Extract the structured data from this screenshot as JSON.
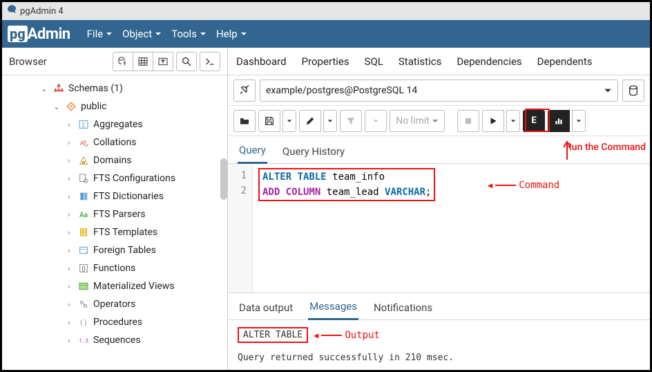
{
  "window": {
    "title": "pgAdmin 4"
  },
  "menubar": {
    "logo_pg": "pg",
    "logo_admin": "Admin",
    "items": [
      "File",
      "Object",
      "Tools",
      "Help"
    ]
  },
  "browser": {
    "title": "Browser",
    "tree": [
      {
        "depth": 3,
        "expand": "down",
        "icon": "schema",
        "label": "Schemas (1)"
      },
      {
        "depth": 4,
        "expand": "down",
        "icon": "public",
        "label": "public"
      },
      {
        "depth": 5,
        "expand": "right",
        "icon": "aggregates",
        "label": "Aggregates"
      },
      {
        "depth": 5,
        "expand": "right",
        "icon": "collations",
        "label": "Collations"
      },
      {
        "depth": 5,
        "expand": "right",
        "icon": "domains",
        "label": "Domains"
      },
      {
        "depth": 5,
        "expand": "right",
        "icon": "ftsconf",
        "label": "FTS Configurations"
      },
      {
        "depth": 5,
        "expand": "right",
        "icon": "ftsdict",
        "label": "FTS Dictionaries"
      },
      {
        "depth": 5,
        "expand": "right",
        "icon": "ftsparser",
        "label": "FTS Parsers"
      },
      {
        "depth": 5,
        "expand": "right",
        "icon": "ftstmpl",
        "label": "FTS Templates"
      },
      {
        "depth": 5,
        "expand": "right",
        "icon": "foreign",
        "label": "Foreign Tables"
      },
      {
        "depth": 5,
        "expand": "right",
        "icon": "functions",
        "label": "Functions"
      },
      {
        "depth": 5,
        "expand": "right",
        "icon": "matview",
        "label": "Materialized Views"
      },
      {
        "depth": 5,
        "expand": "right",
        "icon": "operators",
        "label": "Operators"
      },
      {
        "depth": 5,
        "expand": "right",
        "icon": "procedures",
        "label": "Procedures"
      },
      {
        "depth": 5,
        "expand": "right",
        "icon": "sequences",
        "label": "Sequences"
      }
    ]
  },
  "tabs": {
    "items": [
      "Dashboard",
      "Properties",
      "SQL",
      "Statistics",
      "Dependencies",
      "Dependents"
    ]
  },
  "connection": {
    "value": "example/postgres@PostgreSQL 14"
  },
  "toolbar": {
    "limit": "No limit"
  },
  "query_tabs": {
    "items": [
      "Query",
      "Query History"
    ],
    "active": 0
  },
  "editor": {
    "line_numbers": [
      "1",
      "2"
    ],
    "lines": [
      {
        "tokens": [
          {
            "t": "ALTER TABLE",
            "c": "kw1"
          },
          {
            "t": " team_info",
            "c": ""
          }
        ]
      },
      {
        "tokens": [
          {
            "t": "ADD COLUMN",
            "c": "kw2"
          },
          {
            "t": " team_lead ",
            "c": ""
          },
          {
            "t": "VARCHAR",
            "c": "kw1"
          },
          {
            "t": ";",
            "c": ""
          }
        ]
      }
    ]
  },
  "output_tabs": {
    "items": [
      "Data output",
      "Messages",
      "Notifications"
    ],
    "active": 1
  },
  "output": {
    "result": "ALTER TABLE",
    "status": "Query returned successfully in 210 msec."
  },
  "annotations": {
    "run": "Run the Command",
    "command": "Command",
    "output": "Output"
  }
}
